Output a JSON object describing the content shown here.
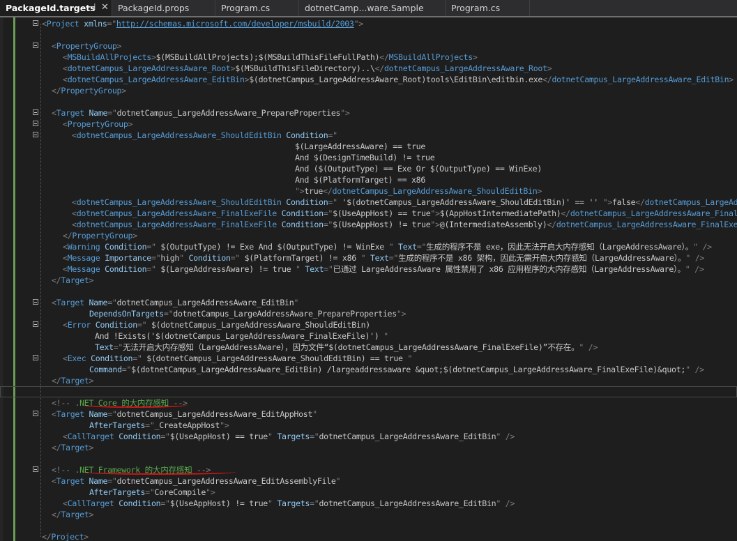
{
  "tabs": [
    {
      "label": "PackageId.targets",
      "active": true
    },
    {
      "label": "PackageId.props"
    },
    {
      "label": "Program.cs"
    },
    {
      "label": "dotnetCamp...ware.Sample"
    },
    {
      "label": "Program.cs"
    }
  ],
  "tab_icons": {
    "pin": "pin-icon",
    "close": "close-icon"
  },
  "colors": {
    "tag": "#569cd6",
    "attribute": "#92caf4",
    "text": "#c8c8c8",
    "punctuation": "#808080",
    "comment": "#57a64a",
    "annotation": "#d01616"
  },
  "code_lines": [
    [
      [
        "p",
        "<"
      ],
      [
        "t",
        "Project"
      ],
      [
        "v",
        " "
      ],
      [
        "a",
        "xmlns"
      ],
      [
        "p",
        "=\""
      ],
      [
        "u",
        "http://schemas.microsoft.com/developer/msbuild/2003"
      ],
      [
        "p",
        "\">"
      ]
    ],
    [],
    [
      [
        "p",
        "<"
      ],
      [
        "t",
        "PropertyGroup"
      ],
      [
        "p",
        ">"
      ]
    ],
    [
      [
        "p",
        "<"
      ],
      [
        "t",
        "MSBuildAllProjects"
      ],
      [
        "p",
        ">"
      ],
      [
        "v",
        "$(MSBuildAllProjects);$(MSBuildThisFileFullPath)"
      ],
      [
        "p",
        "</"
      ],
      [
        "t",
        "MSBuildAllProjects"
      ],
      [
        "p",
        ">"
      ]
    ],
    [
      [
        "p",
        "<"
      ],
      [
        "t",
        "dotnetCampus_LargeAddressAware_Root"
      ],
      [
        "p",
        ">"
      ],
      [
        "v",
        "$(MSBuildThisFileDirectory)..\\"
      ],
      [
        "p",
        "</"
      ],
      [
        "t",
        "dotnetCampus_LargeAddressAware_Root"
      ],
      [
        "p",
        ">"
      ]
    ],
    [
      [
        "p",
        "<"
      ],
      [
        "t",
        "dotnetCampus_LargeAddressAware_EditBin"
      ],
      [
        "p",
        ">"
      ],
      [
        "v",
        "$(dotnetCampus_LargeAddressAware_Root)tools\\EditBin\\editbin.exe"
      ],
      [
        "p",
        "</"
      ],
      [
        "t",
        "dotnetCampus_LargeAddressAware_EditBin"
      ],
      [
        "p",
        ">"
      ]
    ],
    [
      [
        "p",
        "</"
      ],
      [
        "t",
        "PropertyGroup"
      ],
      [
        "p",
        ">"
      ]
    ],
    [],
    [
      [
        "p",
        "<"
      ],
      [
        "t",
        "Target"
      ],
      [
        "v",
        " "
      ],
      [
        "a",
        "Name"
      ],
      [
        "p",
        "=\""
      ],
      [
        "v",
        "dotnetCampus_LargeAddressAware_PrepareProperties"
      ],
      [
        "p",
        "\">"
      ]
    ],
    [
      [
        "p",
        "<"
      ],
      [
        "t",
        "PropertyGroup"
      ],
      [
        "p",
        ">"
      ]
    ],
    [
      [
        "p",
        "<"
      ],
      [
        "t",
        "dotnetCampus_LargeAddressAware_ShouldEditBin"
      ],
      [
        "v",
        " "
      ],
      [
        "a",
        "Condition"
      ],
      [
        "p",
        "=\""
      ]
    ],
    [
      [
        "v",
        "$(LargeAddressAware) == true"
      ]
    ],
    [
      [
        "v",
        "And $(DesignTimeBuild) != true"
      ]
    ],
    [
      [
        "v",
        "And ($(OutputType) == Exe Or $(OutputType) == WinExe)"
      ]
    ],
    [
      [
        "v",
        "And $(PlatformTarget) == x86"
      ]
    ],
    [
      [
        "p",
        "\">"
      ],
      [
        "v",
        "true"
      ],
      [
        "p",
        "</"
      ],
      [
        "t",
        "dotnetCampus_LargeAddressAware_ShouldEditBin"
      ],
      [
        "p",
        ">"
      ]
    ],
    [
      [
        "p",
        "<"
      ],
      [
        "t",
        "dotnetCampus_LargeAddressAware_ShouldEditBin"
      ],
      [
        "v",
        " "
      ],
      [
        "a",
        "Condition"
      ],
      [
        "p",
        "=\""
      ],
      [
        "v",
        " '$(dotnetCampus_LargeAddressAware_ShouldEditBin)' == '' "
      ],
      [
        "p",
        "\">"
      ],
      [
        "v",
        "false"
      ],
      [
        "p",
        "</"
      ],
      [
        "t",
        "dotnetCampus_LargeAddressAware_ShouldEditBin"
      ],
      [
        "p",
        ">"
      ]
    ],
    [
      [
        "p",
        "<"
      ],
      [
        "t",
        "dotnetCampus_LargeAddressAware_FinalExeFile"
      ],
      [
        "v",
        " "
      ],
      [
        "a",
        "Condition"
      ],
      [
        "p",
        "=\""
      ],
      [
        "v",
        "$(UseAppHost) == true"
      ],
      [
        "p",
        "\">"
      ],
      [
        "v",
        "$(AppHostIntermediatePath)"
      ],
      [
        "p",
        "</"
      ],
      [
        "t",
        "dotnetCampus_LargeAddressAware_FinalExeFile"
      ],
      [
        "p",
        ">"
      ]
    ],
    [
      [
        "p",
        "<"
      ],
      [
        "t",
        "dotnetCampus_LargeAddressAware_FinalExeFile"
      ],
      [
        "v",
        " "
      ],
      [
        "a",
        "Condition"
      ],
      [
        "p",
        "=\""
      ],
      [
        "v",
        "$(UseAppHost) != true"
      ],
      [
        "p",
        "\">"
      ],
      [
        "v",
        "@(IntermediateAssembly)"
      ],
      [
        "p",
        "</"
      ],
      [
        "t",
        "dotnetCampus_LargeAddressAware_FinalExeFile"
      ],
      [
        "p",
        ">"
      ]
    ],
    [
      [
        "p",
        "</"
      ],
      [
        "t",
        "PropertyGroup"
      ],
      [
        "p",
        ">"
      ]
    ],
    [
      [
        "p",
        "<"
      ],
      [
        "t",
        "Warning"
      ],
      [
        "v",
        " "
      ],
      [
        "a",
        "Condition"
      ],
      [
        "p",
        "=\""
      ],
      [
        "v",
        " $(OutputType) != Exe And $(OutputType) != WinExe "
      ],
      [
        "p",
        "\""
      ],
      [
        "v",
        " "
      ],
      [
        "a",
        "Text"
      ],
      [
        "p",
        "=\""
      ],
      [
        "v",
        "生成的程序不是 exe，因此无法开启大内存感知（LargeAddressAware）。"
      ],
      [
        "p",
        "\" />"
      ]
    ],
    [
      [
        "p",
        "<"
      ],
      [
        "t",
        "Message"
      ],
      [
        "v",
        " "
      ],
      [
        "a",
        "Importance"
      ],
      [
        "p",
        "=\""
      ],
      [
        "v",
        "high"
      ],
      [
        "p",
        "\""
      ],
      [
        "v",
        " "
      ],
      [
        "a",
        "Condition"
      ],
      [
        "p",
        "=\""
      ],
      [
        "v",
        " $(PlatformTarget) != x86 "
      ],
      [
        "p",
        "\""
      ],
      [
        "v",
        " "
      ],
      [
        "a",
        "Text"
      ],
      [
        "p",
        "=\""
      ],
      [
        "v",
        "生成的程序不是 x86 架构，因此无需开启大内存感知（LargeAddressAware）。"
      ],
      [
        "p",
        "\" />"
      ]
    ],
    [
      [
        "p",
        "<"
      ],
      [
        "t",
        "Message"
      ],
      [
        "v",
        " "
      ],
      [
        "a",
        "Condition"
      ],
      [
        "p",
        "=\""
      ],
      [
        "v",
        " $(LargeAddressAware) != true "
      ],
      [
        "p",
        "\""
      ],
      [
        "v",
        " "
      ],
      [
        "a",
        "Text"
      ],
      [
        "p",
        "=\""
      ],
      [
        "v",
        "已通过 LargeAddressAware 属性禁用了 x86 应用程序的大内存感知（LargeAddressAware）。"
      ],
      [
        "p",
        "\" />"
      ]
    ],
    [
      [
        "p",
        "</"
      ],
      [
        "t",
        "Target"
      ],
      [
        "p",
        ">"
      ]
    ],
    [],
    [
      [
        "p",
        "<"
      ],
      [
        "t",
        "Target"
      ],
      [
        "v",
        " "
      ],
      [
        "a",
        "Name"
      ],
      [
        "p",
        "=\""
      ],
      [
        "v",
        "dotnetCampus_LargeAddressAware_EditBin"
      ],
      [
        "p",
        "\""
      ]
    ],
    [
      [
        "a",
        "DependsOnTargets"
      ],
      [
        "p",
        "=\""
      ],
      [
        "v",
        "dotnetCampus_LargeAddressAware_PrepareProperties"
      ],
      [
        "p",
        "\">"
      ]
    ],
    [
      [
        "p",
        "<"
      ],
      [
        "t",
        "Error"
      ],
      [
        "v",
        " "
      ],
      [
        "a",
        "Condition"
      ],
      [
        "p",
        "=\""
      ],
      [
        "v",
        " $(dotnetCampus_LargeAddressAware_ShouldEditBin)"
      ]
    ],
    [
      [
        "v",
        "And !Exists('$(dotnetCampus_LargeAddressAware_FinalExeFile)') "
      ],
      [
        "p",
        "\""
      ]
    ],
    [
      [
        "a",
        "Text"
      ],
      [
        "p",
        "=\""
      ],
      [
        "v",
        "无法开启大内存感知（LargeAddressAware），因为文件“$(dotnetCampus_LargeAddressAware_FinalExeFile)”不存在。"
      ],
      [
        "p",
        "\" />"
      ]
    ],
    [
      [
        "p",
        "<"
      ],
      [
        "t",
        "Exec"
      ],
      [
        "v",
        " "
      ],
      [
        "a",
        "Condition"
      ],
      [
        "p",
        "=\""
      ],
      [
        "v",
        " $(dotnetCampus_LargeAddressAware_ShouldEditBin) == true "
      ],
      [
        "p",
        "\""
      ]
    ],
    [
      [
        "a",
        "Command"
      ],
      [
        "p",
        "=\""
      ],
      [
        "v",
        "$(dotnetCampus_LargeAddressAware_EditBin) /largeaddressaware &quot;$(dotnetCampus_LargeAddressAware_FinalExeFile)&quot;"
      ],
      [
        "p",
        "\" />"
      ]
    ],
    [
      [
        "p",
        "</"
      ],
      [
        "t",
        "Target"
      ],
      [
        "p",
        ">"
      ]
    ],
    [],
    [
      [
        "p",
        "<!-- "
      ],
      [
        "c",
        ".NET Core 的大内存感知"
      ],
      [
        "p",
        " -->"
      ]
    ],
    [
      [
        "p",
        "<"
      ],
      [
        "t",
        "Target"
      ],
      [
        "v",
        " "
      ],
      [
        "a",
        "Name"
      ],
      [
        "p",
        "=\""
      ],
      [
        "v",
        "dotnetCampus_LargeAddressAware_EditAppHost"
      ],
      [
        "p",
        "\""
      ]
    ],
    [
      [
        "a",
        "AfterTargets"
      ],
      [
        "p",
        "=\""
      ],
      [
        "v",
        "_CreateAppHost"
      ],
      [
        "p",
        "\">"
      ]
    ],
    [
      [
        "p",
        "<"
      ],
      [
        "t",
        "CallTarget"
      ],
      [
        "v",
        " "
      ],
      [
        "a",
        "Condition"
      ],
      [
        "p",
        "=\""
      ],
      [
        "v",
        "$(UseAppHost) == true"
      ],
      [
        "p",
        "\""
      ],
      [
        "v",
        " "
      ],
      [
        "a",
        "Targets"
      ],
      [
        "p",
        "=\""
      ],
      [
        "v",
        "dotnetCampus_LargeAddressAware_EditBin"
      ],
      [
        "p",
        "\" />"
      ]
    ],
    [
      [
        "p",
        "</"
      ],
      [
        "t",
        "Target"
      ],
      [
        "p",
        ">"
      ]
    ],
    [],
    [
      [
        "p",
        "<!-- "
      ],
      [
        "c",
        ".NET Framework 的大内存感知"
      ],
      [
        "p",
        " -->"
      ]
    ],
    [
      [
        "p",
        "<"
      ],
      [
        "t",
        "Target"
      ],
      [
        "v",
        " "
      ],
      [
        "a",
        "Name"
      ],
      [
        "p",
        "=\""
      ],
      [
        "v",
        "dotnetCampus_LargeAddressAware_EditAssemblyFile"
      ],
      [
        "p",
        "\""
      ]
    ],
    [
      [
        "a",
        "AfterTargets"
      ],
      [
        "p",
        "=\""
      ],
      [
        "v",
        "CoreCompile"
      ],
      [
        "p",
        "\">"
      ]
    ],
    [
      [
        "p",
        "<"
      ],
      [
        "t",
        "CallTarget"
      ],
      [
        "v",
        " "
      ],
      [
        "a",
        "Condition"
      ],
      [
        "p",
        "=\""
      ],
      [
        "v",
        "$(UseAppHost) != true"
      ],
      [
        "p",
        "\""
      ],
      [
        "v",
        " "
      ],
      [
        "a",
        "Targets"
      ],
      [
        "p",
        "=\""
      ],
      [
        "v",
        "dotnetCampus_LargeAddressAware_EditBin"
      ],
      [
        "p",
        "\" />"
      ]
    ],
    [
      [
        "p",
        "</"
      ],
      [
        "t",
        "Target"
      ],
      [
        "p",
        ">"
      ]
    ],
    [],
    [
      [
        "p",
        "</"
      ],
      [
        "t",
        "Project"
      ],
      [
        "p",
        ">"
      ]
    ]
  ]
}
